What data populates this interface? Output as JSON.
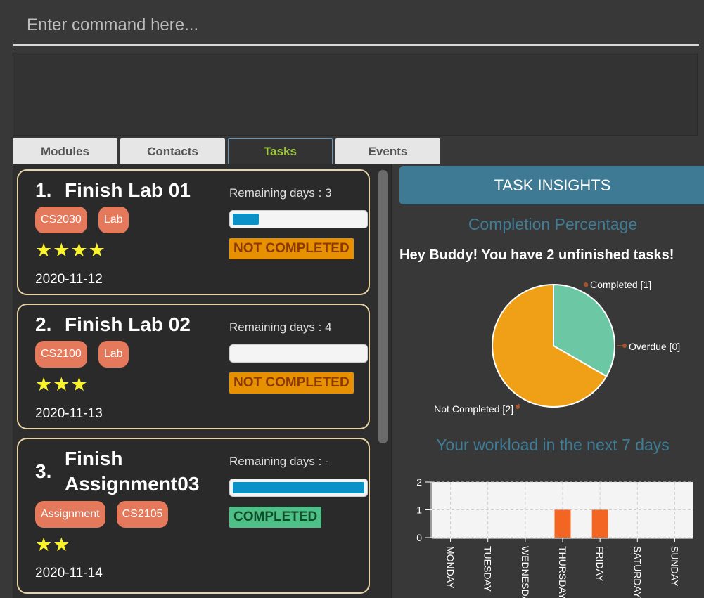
{
  "command": {
    "placeholder": "Enter command here..."
  },
  "tabs": [
    {
      "label": "Modules",
      "active": false
    },
    {
      "label": "Contacts",
      "active": false
    },
    {
      "label": "Tasks",
      "active": true
    },
    {
      "label": "Events",
      "active": false
    }
  ],
  "tasks": [
    {
      "number": "1.",
      "title": "Finish Lab 01",
      "tags": [
        "CS2030",
        "Lab"
      ],
      "stars": "★★★★",
      "date": "2020-11-12",
      "remaining": "Remaining days : 3",
      "progress": 0.2,
      "status": "NOT COMPLETED"
    },
    {
      "number": "2.",
      "title": "Finish Lab 02",
      "tags": [
        "CS2100",
        "Lab"
      ],
      "stars": "★★★",
      "date": "2020-11-13",
      "remaining": "Remaining days : 4",
      "progress": 0.0,
      "status": "NOT COMPLETED"
    },
    {
      "number": "3.",
      "title": "Finish Assignment03",
      "title_lines": [
        "Finish",
        "Assignment03"
      ],
      "tags": [
        "Assignment",
        "CS2105"
      ],
      "stars": "★★",
      "date": "2020-11-14",
      "remaining": "Remaining days : -",
      "progress": 1.0,
      "status": "COMPLETED"
    }
  ],
  "insights": {
    "header": "TASK INSIGHTS",
    "completion_title": "Completion Percentage",
    "summary": "Hey Buddy! You have 2 unfinished tasks!",
    "workload_title": "Your workload in the next 7 days"
  },
  "colors": {
    "accent": "#3e7a93",
    "tag": "#e5795b",
    "not_completed": "#e89100",
    "completed": "#4fbf88",
    "progress": "#0a91c8",
    "bar": "#f26522"
  },
  "chart_data": [
    {
      "type": "pie",
      "labels": [
        "Completed [1]",
        "Overdue [0]",
        "Not Completed [2]"
      ],
      "values": [
        1,
        0,
        2
      ],
      "colors": [
        "#6bc7a4",
        "#ea4b35",
        "#f0a017"
      ]
    },
    {
      "type": "bar",
      "categories": [
        "MONDAY",
        "TUESDAY",
        "WEDNESDAY",
        "THURSDAY",
        "FRIDAY",
        "SATURDAY",
        "SUNDAY"
      ],
      "values": [
        0,
        0,
        0,
        1,
        1,
        0,
        0
      ],
      "ylim": [
        0,
        2
      ],
      "yticks": [
        "0",
        "1",
        "2"
      ],
      "grid": true
    }
  ]
}
